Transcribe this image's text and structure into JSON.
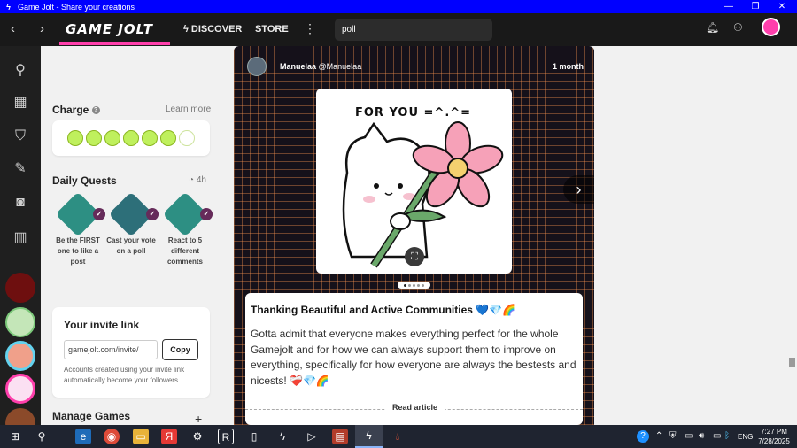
{
  "window": {
    "title": "Game Jolt - Share your creations",
    "icon": "gamejolt-bolt-icon",
    "controls": [
      "—",
      "❐",
      "✕"
    ]
  },
  "nav": {
    "back": "‹",
    "forward": "›",
    "logo": "GAME JOLT",
    "discover": "DISCOVER",
    "store": "STORE",
    "more": "⋮",
    "search_value": "poll"
  },
  "sidebar": {
    "charge": {
      "title": "Charge",
      "learn_more": "Learn more",
      "filled": 6,
      "total": 7
    },
    "daily_quests": {
      "title": "Daily Quests",
      "timer": "4h",
      "quests": [
        {
          "label": "Be the FIRST one to like a post",
          "color": "#2d8f83"
        },
        {
          "label": "Cast your vote on a poll",
          "color": "#2d6f79"
        },
        {
          "label": "React to 5 different comments",
          "color": "#2d8f83"
        }
      ]
    },
    "invite": {
      "title": "Your invite link",
      "link_value": "gamejolt.com/invite/",
      "copy": "Copy",
      "note": "Accounts created using your invite link automatically become your followers."
    },
    "manage_games": {
      "title": "Manage Games",
      "add": "+"
    }
  },
  "post": {
    "display_name": "Manuelaa",
    "username": "@Manuelaa",
    "time": "1 month",
    "title": "Thanking Beautiful and Active Communities 💙💎🌈",
    "body": "Gotta admit that everyone makes everything perfect for the whole Gamejolt and for how we can always support them to improve on everything, specifically for how everyone are always the bestests and nicests! ❤️‍🩹💎🌈",
    "read_article": "Read article",
    "image_caption": "FOR YOU =^.^=",
    "slide_count": 5,
    "slide_active": 0
  },
  "taskbar": {
    "time": "7:27 PM",
    "date": "7/28/2025",
    "lang": "ENG"
  },
  "colors": {
    "brand": "#ff3fac",
    "charge": "#bff05d",
    "titlebar": "#0000ff"
  }
}
